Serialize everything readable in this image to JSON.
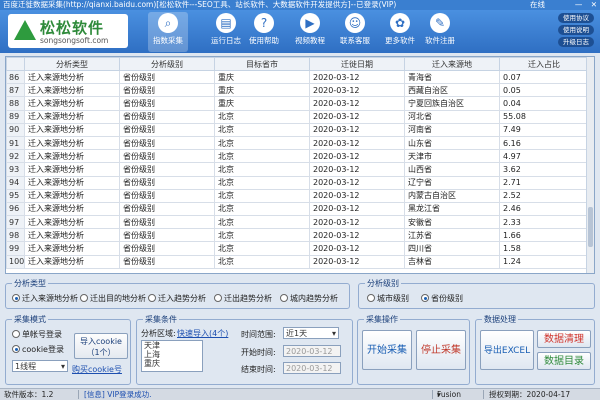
{
  "window": {
    "title": "百度迁徙数据采集(http://qianxi.baidu.com)[松松软件---SEO工具、站长软件、大数据软件开发提供方]--已登录(VIP)",
    "online": "在线",
    "min": "—",
    "close": "✕"
  },
  "logo": {
    "name": "松松软件",
    "url": "songsongsoft.com"
  },
  "toolbar": [
    {
      "label": "指数采集",
      "icon": "magnify-icon",
      "glyph": "⌕"
    },
    {
      "label": "运行日志",
      "icon": "log-icon",
      "glyph": "▤"
    },
    {
      "label": "使用帮助",
      "icon": "help-icon",
      "glyph": "?"
    },
    {
      "label": "视频教程",
      "icon": "video-icon",
      "glyph": "▶"
    },
    {
      "label": "联系客服",
      "icon": "chat-icon",
      "glyph": "☺"
    },
    {
      "label": "更多软件",
      "icon": "apps-icon",
      "glyph": "✿"
    },
    {
      "label": "软件注册",
      "icon": "register-icon",
      "glyph": "✎"
    }
  ],
  "right_buttons": [
    "使用协议",
    "使用说明",
    "升级日志"
  ],
  "table": {
    "columns": [
      "分析类型",
      "分析级别",
      "目标省市",
      "迁徙日期",
      "迁入来源地",
      "迁入占比"
    ],
    "rows": [
      [
        "86",
        "迁入来源地分析",
        "省份级别",
        "重庆",
        "2020-03-12",
        "青海省",
        "0.07"
      ],
      [
        "87",
        "迁入来源地分析",
        "省份级别",
        "重庆",
        "2020-03-12",
        "西藏自治区",
        "0.05"
      ],
      [
        "88",
        "迁入来源地分析",
        "省份级别",
        "重庆",
        "2020-03-12",
        "宁夏回族自治区",
        "0.04"
      ],
      [
        "89",
        "迁入来源地分析",
        "省份级别",
        "北京",
        "2020-03-12",
        "河北省",
        "55.08"
      ],
      [
        "90",
        "迁入来源地分析",
        "省份级别",
        "北京",
        "2020-03-12",
        "河南省",
        "7.49"
      ],
      [
        "91",
        "迁入来源地分析",
        "省份级别",
        "北京",
        "2020-03-12",
        "山东省",
        "6.16"
      ],
      [
        "92",
        "迁入来源地分析",
        "省份级别",
        "北京",
        "2020-03-12",
        "天津市",
        "4.97"
      ],
      [
        "93",
        "迁入来源地分析",
        "省份级别",
        "北京",
        "2020-03-12",
        "山西省",
        "3.62"
      ],
      [
        "94",
        "迁入来源地分析",
        "省份级别",
        "北京",
        "2020-03-12",
        "辽宁省",
        "2.71"
      ],
      [
        "95",
        "迁入来源地分析",
        "省份级别",
        "北京",
        "2020-03-12",
        "内蒙古自治区",
        "2.52"
      ],
      [
        "96",
        "迁入来源地分析",
        "省份级别",
        "北京",
        "2020-03-12",
        "黑龙江省",
        "2.46"
      ],
      [
        "97",
        "迁入来源地分析",
        "省份级别",
        "北京",
        "2020-03-12",
        "安徽省",
        "2.33"
      ],
      [
        "98",
        "迁入来源地分析",
        "省份级别",
        "北京",
        "2020-03-12",
        "江苏省",
        "1.66"
      ],
      [
        "99",
        "迁入来源地分析",
        "省份级别",
        "北京",
        "2020-03-12",
        "四川省",
        "1.58"
      ],
      [
        "100",
        "迁入来源地分析",
        "省份级别",
        "北京",
        "2020-03-12",
        "吉林省",
        "1.24"
      ]
    ]
  },
  "analysis_type": {
    "label": "分析类型",
    "options": [
      "迁入来源地分析",
      "迁出目的地分析",
      "迁入趋势分析",
      "迁出趋势分析",
      "城内趋势分析"
    ],
    "selected_index": 0
  },
  "analysis_level": {
    "label": "分析级别",
    "options": [
      "城市级别",
      "省份级别"
    ],
    "selected_index": 1
  },
  "collect_mode": {
    "label": "采集模式",
    "options": [
      "单帐号登录",
      "cookie登录"
    ],
    "selected_index": 1,
    "import_button": "导入cookie（1个）",
    "threads": "1线程",
    "buy_link": "购买cookie号"
  },
  "collect_conditions": {
    "label": "采集条件",
    "region_label": "分析区域:",
    "import_link": "快速导入(4个)",
    "regions": [
      "天津",
      "上海",
      "重庆"
    ],
    "time_range_label": "时间范围:",
    "time_range": "近1天",
    "start_label": "开始时间:",
    "start_value": "2020-03-12",
    "end_label": "结束时间:",
    "end_value": "2020-03-12"
  },
  "operations": {
    "label": "采集操作",
    "start": "开始采集",
    "stop": "停止采集"
  },
  "data_processing": {
    "label": "数据处理",
    "export": "导出EXCEL",
    "clean": "数据清理",
    "dir": "数据目录"
  },
  "status": {
    "version": "软件版本：1.2",
    "message": "[信息] VIP登录成功.",
    "skin": "Fusion",
    "expire": "授权到期：2020-04-17"
  },
  "colors": {
    "accent": "#2f6fc3",
    "start": "#1a5fb4",
    "stop": "#c0392b",
    "clean": "#d0342c",
    "dir": "#2e8a3a"
  }
}
